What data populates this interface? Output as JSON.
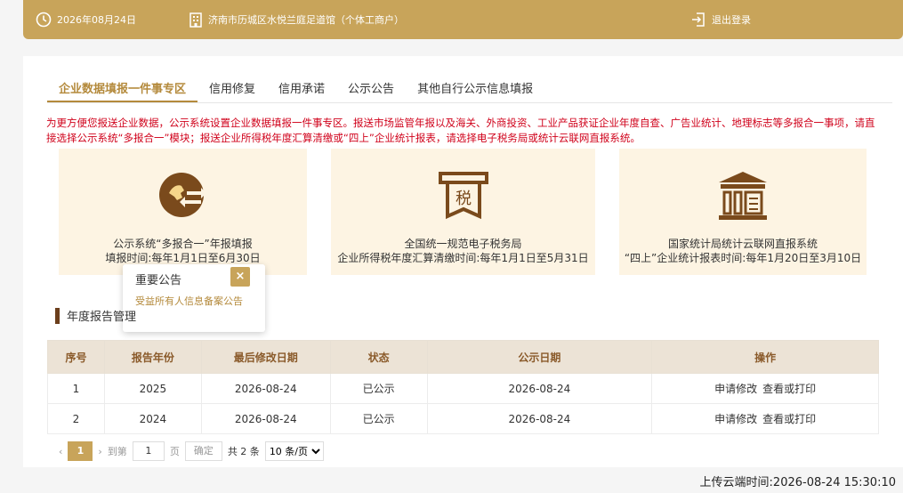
{
  "header": {
    "date": "2026年08月24日",
    "business_name": "济南市历城区水悦兰庭足道馆（个体工商户）",
    "logout_label": "退出登录"
  },
  "tabs": [
    {
      "label": "企业数据填报一件事专区",
      "active": true
    },
    {
      "label": "信用修复",
      "active": false
    },
    {
      "label": "信用承诺",
      "active": false
    },
    {
      "label": "公示公告",
      "active": false
    },
    {
      "label": "其他自行公示信息填报",
      "active": false
    }
  ],
  "notice": "为更方便您报送企业数据，公示系统设置企业数据填报一件事专区。报送市场监管年报以及海关、外商投资、工业产品获证企业年度自查、广告业统计、地理标志等多报合一事项，请直接选择公示系统“多报合一”模块；报送企业所得税年度汇算清缴或“四上”企业统计报表，请选择电子税务局或统计云联网直报系统。",
  "cards": [
    {
      "icon": "multi-report-icon",
      "line1": "公示系统“多报合一”年报填报",
      "line2": "填报时间:每年1月1日至6月30日"
    },
    {
      "icon": "tax-icon",
      "icon_text": "税",
      "line1": "全国统一规范电子税务局",
      "line2": "企业所得税年度汇算清缴时间:每年1月1日至5月31日"
    },
    {
      "icon": "statistics-bureau-icon",
      "line1": "国家统计局统计云联网直报系统",
      "line2": "“四上”企业统计报表时间:每年1月20日至3月10日"
    }
  ],
  "popup": {
    "title": "重要公告",
    "close": "×",
    "link": "受益所有人信息备案公告"
  },
  "section_title": "年度报告管理",
  "table": {
    "headers": [
      "序号",
      "报告年份",
      "最后修改日期",
      "状态",
      "公示日期",
      "操作"
    ],
    "rows": [
      {
        "no": "1",
        "year": "2025",
        "modified": "2026-08-24",
        "status": "已公示",
        "published": "2026-08-24",
        "op1": "申请修改",
        "op2": "查看或打印"
      },
      {
        "no": "2",
        "year": "2024",
        "modified": "2026-08-24",
        "status": "已公示",
        "published": "2026-08-24",
        "op1": "申请修改",
        "op2": "查看或打印"
      }
    ]
  },
  "pager": {
    "current": "1",
    "goto_prefix": "到第",
    "goto_value": "1",
    "goto_suffix": "页",
    "confirm": "确定",
    "total": "共 2 条",
    "page_size": "10 条/页"
  },
  "footer": {
    "upload_time": "上传云端时间:2026-08-24 15:30:10"
  },
  "colors": {
    "accent": "#c8a45a",
    "notice": "#d0021b",
    "card_bg": "#fdf4e3"
  }
}
